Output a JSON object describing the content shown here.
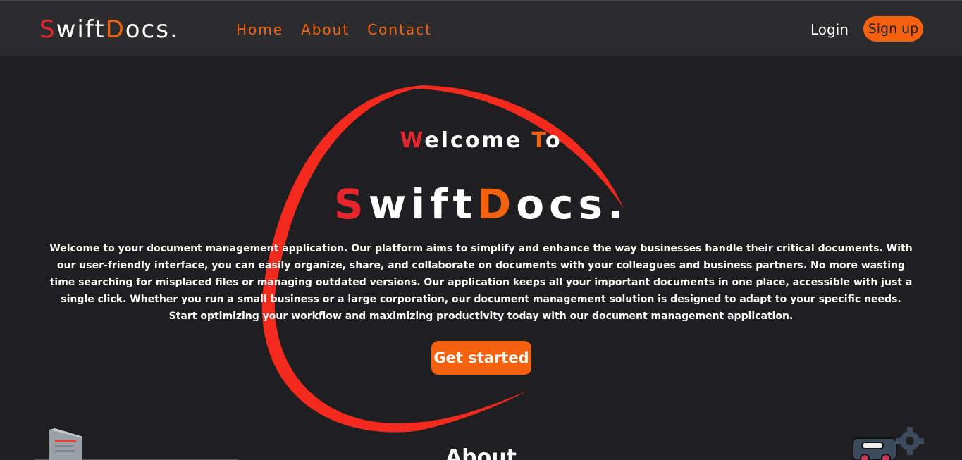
{
  "nav": {
    "brand": {
      "first_letter": "S",
      "middle": "wift",
      "accent_letter": "D",
      "rest": "ocs."
    },
    "links": [
      {
        "label": "Home"
      },
      {
        "label": "About"
      },
      {
        "label": "Contact"
      }
    ],
    "login_label": "Login",
    "signup_label": "Sign up"
  },
  "hero": {
    "welcome": {
      "first_letter": "W",
      "middle": "elcome ",
      "accent_letter": "T",
      "rest": "o"
    },
    "title": {
      "first_letter": "S",
      "middle": "wift",
      "accent_letter": "D",
      "rest": "ocs."
    },
    "description": "Welcome to your document management application. Our platform aims to simplify and enhance the way businesses handle their critical documents. With our user-friendly interface, you can easily organize, share, and collaborate on documents with your colleagues and business partners. No more wasting time searching for misplaced files or managing outdated versions. Our application keeps all your important documents in one place, accessible with just a single click. Whether you run a small business or a large corporation, our document management solution is designed to adapt to your specific needs. Start optimizing your workflow and maximizing productivity today with our document management application.",
    "cta_label": "Get started"
  },
  "about": {
    "heading": "About"
  },
  "colors": {
    "background": "#1f1f21",
    "navbar": "#2c2c2e",
    "accent_red": "#e5262f",
    "accent_orange": "#f4620f",
    "swirl": "#f42a1e"
  },
  "icons": [
    "swirl-decoration",
    "document-illustration-icon",
    "gear-illustration-icon"
  ]
}
